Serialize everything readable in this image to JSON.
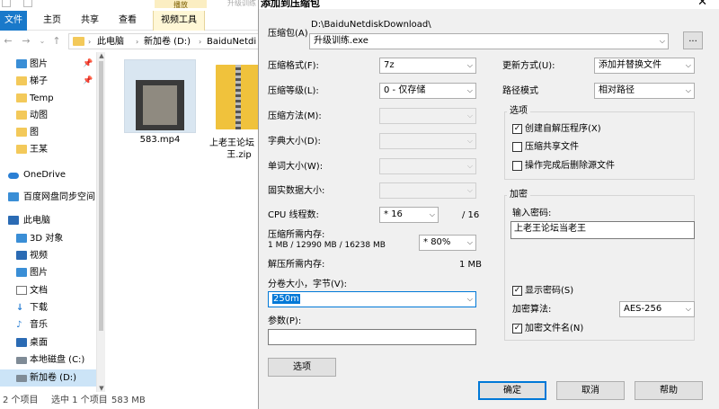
{
  "explorer": {
    "ribbon_context_label": "播放",
    "ribbon_faded_label": "升级训练",
    "tabs": [
      "文件",
      "主页",
      "共享",
      "查看",
      "视频工具"
    ],
    "breadcrumb": [
      "此电脑",
      "新加卷 (D:)",
      "BaiduNetdi"
    ],
    "nav_items": [
      {
        "label": "图片",
        "icon": "pictures-icon",
        "pinned": true
      },
      {
        "label": "梯子",
        "icon": "folder-icon",
        "pinned": true
      },
      {
        "label": "Temp",
        "icon": "folder-icon"
      },
      {
        "label": "动图",
        "icon": "folder-icon"
      },
      {
        "label": "图",
        "icon": "folder-icon"
      },
      {
        "label": "王某",
        "icon": "folder-icon"
      },
      {
        "label": "OneDrive",
        "icon": "onedrive-icon"
      },
      {
        "label": "百度网盘同步空间",
        "icon": "baidu-sync-icon"
      },
      {
        "label": "此电脑",
        "icon": "this-pc-icon"
      },
      {
        "label": "3D 对象",
        "icon": "3d-objects-icon"
      },
      {
        "label": "视频",
        "icon": "videos-icon"
      },
      {
        "label": "图片",
        "icon": "pictures-icon"
      },
      {
        "label": "文档",
        "icon": "documents-icon"
      },
      {
        "label": "下载",
        "icon": "downloads-icon"
      },
      {
        "label": "音乐",
        "icon": "music-icon"
      },
      {
        "label": "桌面",
        "icon": "desktop-icon"
      },
      {
        "label": "本地磁盘 (C:)",
        "icon": "drive-icon"
      },
      {
        "label": "新加卷 (D:)",
        "icon": "drive-icon",
        "selected": true
      }
    ],
    "files": [
      {
        "name": "583.mp4",
        "type": "video"
      },
      {
        "name_line1": "上老王论坛",
        "name_line2": "王.zip",
        "type": "zip"
      }
    ],
    "status": {
      "items": "2 个项目",
      "selected": "选中 1 个项目",
      "size": "583 MB"
    }
  },
  "dialog": {
    "title": "添加到压缩包",
    "close_glyph": "✕",
    "archive_label": "压缩包(A)",
    "archive_path": "D:\\BaiduNetdiskDownload\\",
    "archive_name": "升级训练.exe",
    "browse_label": "...",
    "format_label": "压缩格式(F):",
    "format_value": "7z",
    "level_label": "压缩等级(L):",
    "level_value": "0 - 仅存储",
    "method_label": "压缩方法(M):",
    "dict_label": "字典大小(D):",
    "word_label": "单词大小(W):",
    "solid_label": "固实数据大小:",
    "cpu_label": "CPU 线程数:",
    "cpu_value": "16",
    "cpu_total": "/ 16",
    "mem_comp_label": "压缩所需内存:",
    "mem_comp_value": "1 MB / 12990 MB / 16238 MB",
    "mem_percent": "80%",
    "mem_decomp_label": "解压所需内存:",
    "mem_decomp_value": "1 MB",
    "split_label": "分卷大小，字节(V):",
    "split_value": "250m",
    "params_label": "参数(P):",
    "params_value": "",
    "options_button": "选项",
    "update_label": "更新方式(U):",
    "update_value": "添加并替换文件",
    "path_label": "路径模式",
    "path_value": "相对路径",
    "options_group": "选项",
    "opt_sfx": "创建自解压程序(X)",
    "opt_sfx_checked": true,
    "opt_shared": "压缩共享文件",
    "opt_shared_checked": false,
    "opt_delete": "操作完成后删除源文件",
    "opt_delete_checked": false,
    "encrypt_group": "加密",
    "password_label": "输入密码:",
    "password_value": "上老王论坛当老王",
    "show_password": "显示密码(S)",
    "show_password_checked": true,
    "enc_method_label": "加密算法:",
    "enc_method_value": "AES-256",
    "encrypt_names": "加密文件名(N)",
    "encrypt_names_checked": true,
    "ok_button": "确定",
    "cancel_button": "取消",
    "help_button": "帮助"
  }
}
